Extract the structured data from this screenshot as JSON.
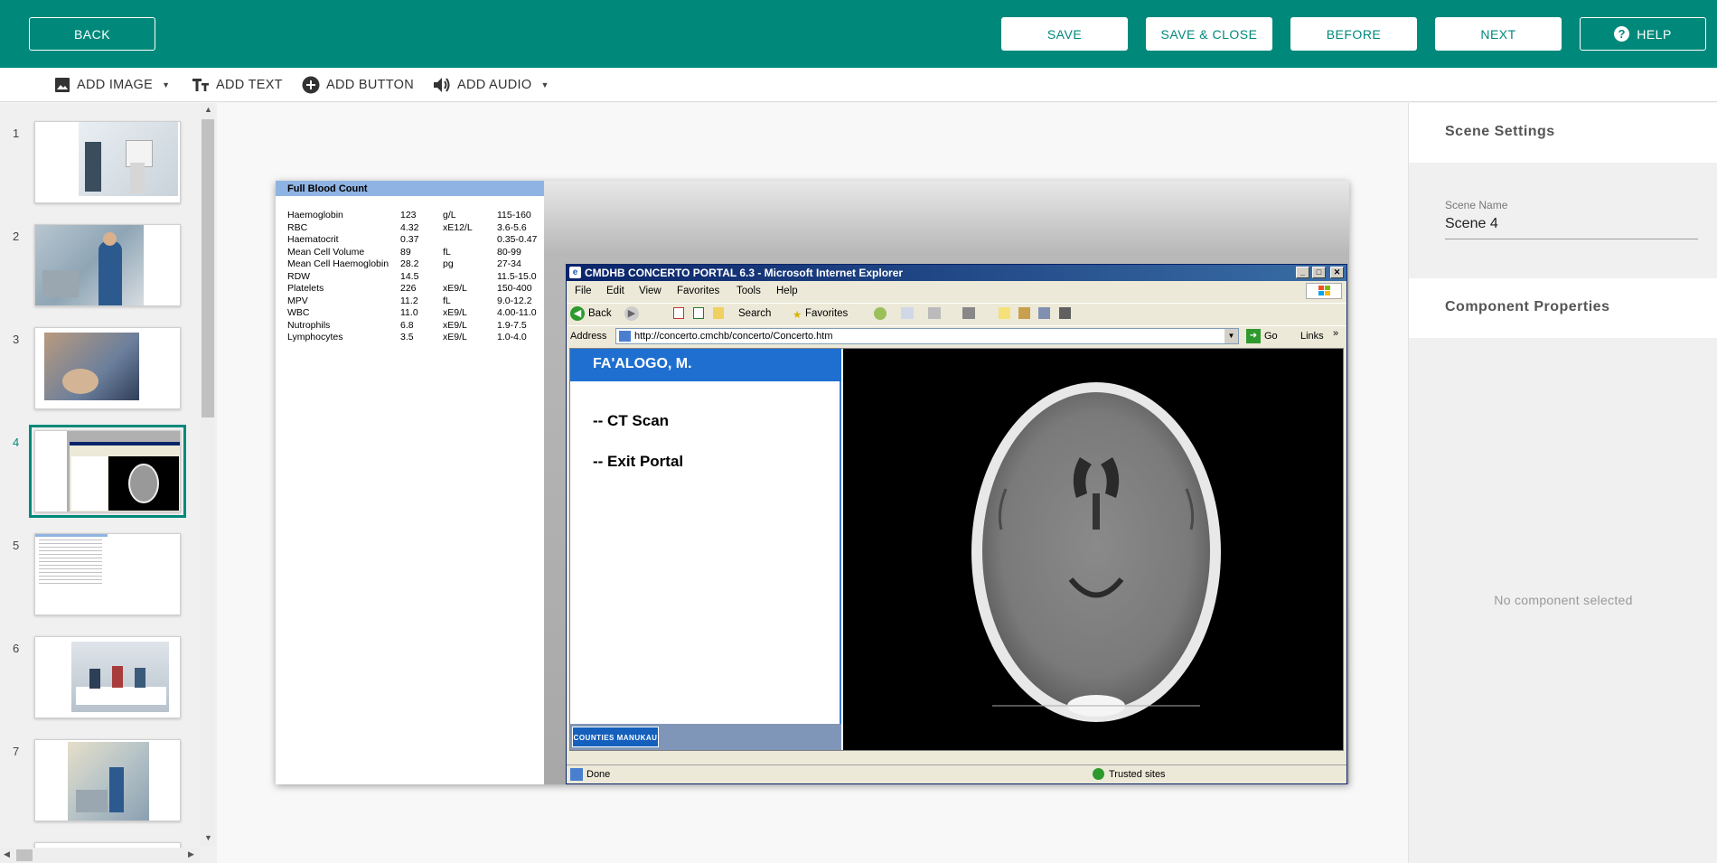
{
  "topbar": {
    "back_label": "BACK",
    "save_label": "SAVE",
    "save_close_label": "SAVE & CLOSE",
    "before_label": "BEFORE",
    "next_label": "NEXT",
    "help_label": "HELP",
    "help_icon": "question-circle-icon",
    "bg_color": "#00897b"
  },
  "toolbar": {
    "add_image": "ADD IMAGE",
    "add_text": "ADD TEXT",
    "add_button": "ADD BUTTON",
    "add_audio": "ADD AUDIO"
  },
  "slides": {
    "numbers": [
      "1",
      "2",
      "3",
      "4",
      "5",
      "6",
      "7"
    ],
    "selected": "4"
  },
  "scene": {
    "fbc_title": "Full Blood Count",
    "fbc_rows": [
      [
        "Haemoglobin",
        "123",
        "g/L",
        "115-160"
      ],
      [
        "RBC",
        "4.32",
        "xE12/L",
        "3.6-5.6"
      ],
      [
        "Haematocrit",
        "0.37",
        "",
        "0.35-0.47"
      ],
      [
        "Mean Cell Volume",
        "89",
        "fL",
        "80-99"
      ],
      [
        "Mean Cell Haemoglobin",
        "28.2",
        "pg",
        "27-34"
      ],
      [
        "RDW",
        "14.5",
        "",
        "11.5-15.0"
      ],
      [
        "Platelets",
        "226",
        "xE9/L",
        "150-400"
      ],
      [
        "MPV",
        "11.2",
        "fL",
        "9.0-12.2"
      ],
      [
        "WBC",
        "11.0",
        "xE9/L",
        "4.00-11.0"
      ],
      [
        "Nutrophils",
        "6.8",
        "xE9/L",
        "1.9-7.5"
      ],
      [
        "Lymphocytes",
        "3.5",
        "xE9/L",
        "1.0-4.0"
      ]
    ],
    "ie_title": "CMDHB CONCERTO PORTAL 6.3 - Microsoft Internet Explorer",
    "ie_menu": [
      "File",
      "Edit",
      "View",
      "Favorites",
      "Tools",
      "Help"
    ],
    "ie_toolbar": {
      "back": "Back",
      "search": "Search",
      "favorites": "Favorites"
    },
    "ie_address_label": "Address",
    "ie_address": "http://concerto.cmchb/concerto/Concerto.htm",
    "ie_go": "Go",
    "ie_links": "Links",
    "patient_name": "FA'ALOGO, M.",
    "link_ct": "-- CT Scan",
    "link_exit": "-- Exit Portal",
    "logo_text": "COUNTIES MANUKAU",
    "status_done": "Done",
    "status_zone": "Trusted sites"
  },
  "rpanel": {
    "scene_settings": "Scene Settings",
    "scene_name_label": "Scene Name",
    "scene_name_value": "Scene 4",
    "component_properties": "Component Properties",
    "no_component": "No component selected"
  }
}
